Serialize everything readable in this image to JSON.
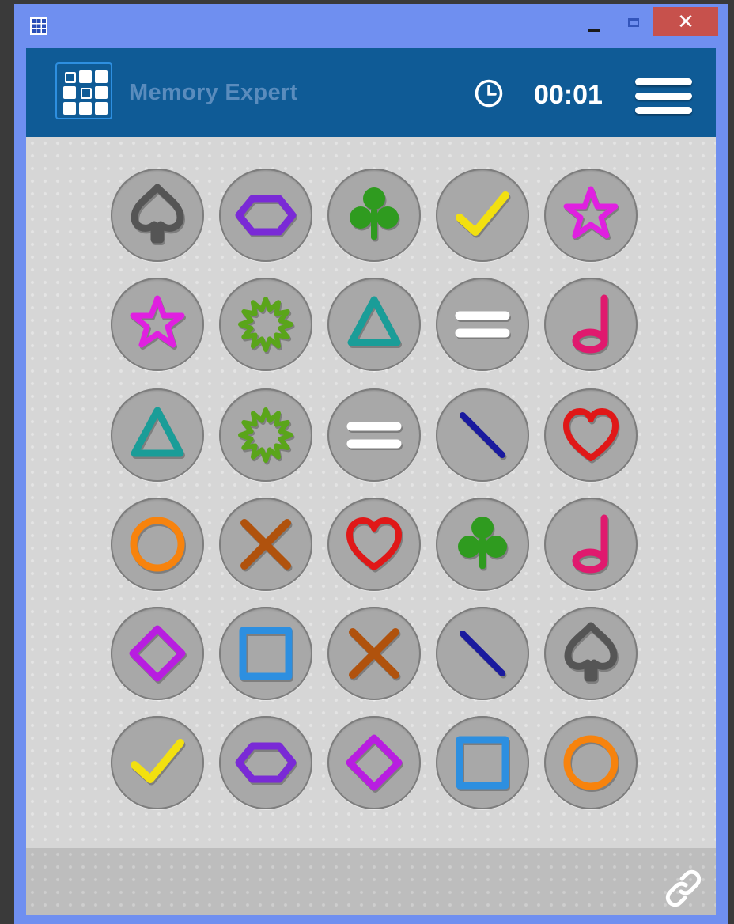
{
  "window": {
    "close_label": "✕",
    "chrome_color": "#6f8ff0",
    "close_color": "#c7514c"
  },
  "header": {
    "title": "Memory Expert",
    "timer": "00:01",
    "background": "#0f5b96",
    "title_color": "#5a8cbd",
    "icons": [
      "app-grid-icon",
      "clock-icon",
      "hamburger-menu-icon"
    ]
  },
  "board": {
    "rows": 6,
    "columns": 5,
    "cards": [
      {
        "row": 1,
        "col": 1,
        "symbol": "spade",
        "color": "#555555"
      },
      {
        "row": 1,
        "col": 2,
        "symbol": "hexagon",
        "color": "#7a2ad6"
      },
      {
        "row": 1,
        "col": 3,
        "symbol": "club",
        "color": "#2f9b1f"
      },
      {
        "row": 1,
        "col": 4,
        "symbol": "checkmark",
        "color": "#f2e010"
      },
      {
        "row": 1,
        "col": 5,
        "symbol": "star",
        "color": "#e020e0"
      },
      {
        "row": 2,
        "col": 1,
        "symbol": "star",
        "color": "#e020e0"
      },
      {
        "row": 2,
        "col": 2,
        "symbol": "burst",
        "color": "#5aa51a"
      },
      {
        "row": 2,
        "col": 3,
        "symbol": "triangle",
        "color": "#1a9d98"
      },
      {
        "row": 2,
        "col": 4,
        "symbol": "equals",
        "color": "#ffffff"
      },
      {
        "row": 2,
        "col": 5,
        "symbol": "music-note",
        "color": "#e0196e"
      },
      {
        "row": 3,
        "col": 1,
        "symbol": "triangle",
        "color": "#1a9d98"
      },
      {
        "row": 3,
        "col": 2,
        "symbol": "burst",
        "color": "#5aa51a"
      },
      {
        "row": 3,
        "col": 3,
        "symbol": "equals",
        "color": "#ffffff"
      },
      {
        "row": 3,
        "col": 4,
        "symbol": "slash",
        "color": "#1a1a9e"
      },
      {
        "row": 3,
        "col": 5,
        "symbol": "heart",
        "color": "#e01818"
      },
      {
        "row": 4,
        "col": 1,
        "symbol": "circle",
        "color": "#f7830d"
      },
      {
        "row": 4,
        "col": 2,
        "symbol": "cross",
        "color": "#b0520d"
      },
      {
        "row": 4,
        "col": 3,
        "symbol": "heart",
        "color": "#e01818"
      },
      {
        "row": 4,
        "col": 4,
        "symbol": "club",
        "color": "#2f9b1f"
      },
      {
        "row": 4,
        "col": 5,
        "symbol": "music-note",
        "color": "#e0196e"
      },
      {
        "row": 5,
        "col": 1,
        "symbol": "diamond",
        "color": "#b81ee0"
      },
      {
        "row": 5,
        "col": 2,
        "symbol": "square",
        "color": "#2d8fe0"
      },
      {
        "row": 5,
        "col": 3,
        "symbol": "cross",
        "color": "#b0520d"
      },
      {
        "row": 5,
        "col": 4,
        "symbol": "slash",
        "color": "#1a1a9e"
      },
      {
        "row": 5,
        "col": 5,
        "symbol": "spade",
        "color": "#555555"
      },
      {
        "row": 6,
        "col": 1,
        "symbol": "checkmark",
        "color": "#f2e010"
      },
      {
        "row": 6,
        "col": 2,
        "symbol": "hexagon",
        "color": "#7a2ad6"
      },
      {
        "row": 6,
        "col": 3,
        "symbol": "diamond",
        "color": "#b81ee0"
      },
      {
        "row": 6,
        "col": 4,
        "symbol": "square",
        "color": "#2d8fe0"
      },
      {
        "row": 6,
        "col": 5,
        "symbol": "circle",
        "color": "#f7830d"
      }
    ]
  },
  "footer": {
    "icon": "link-icon"
  }
}
